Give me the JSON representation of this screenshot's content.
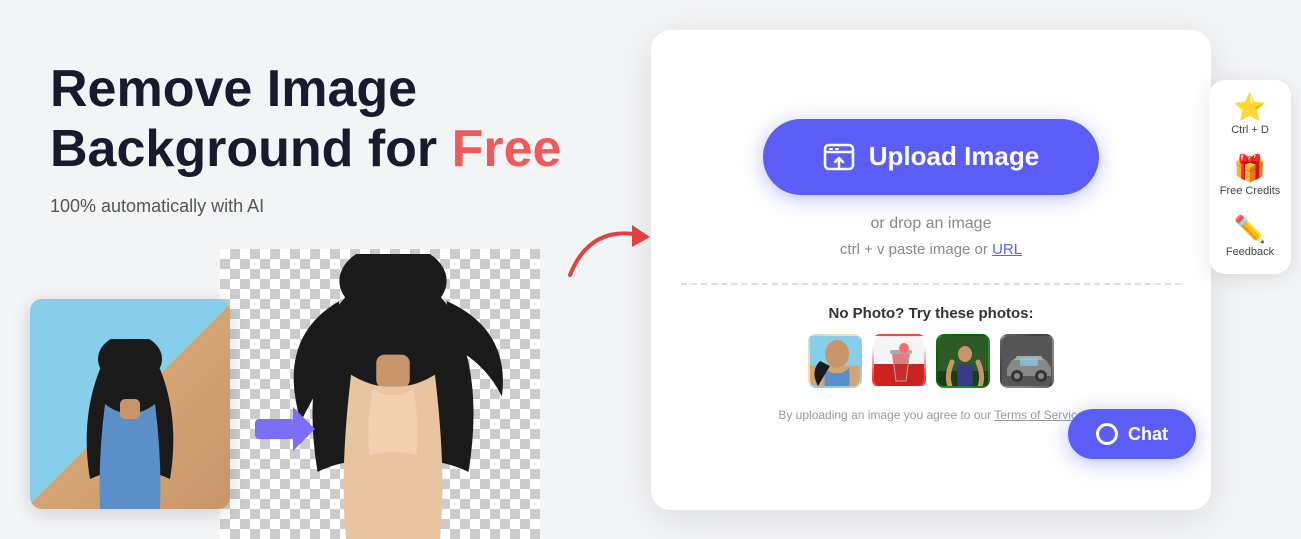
{
  "headline": {
    "line1": "Remove Image",
    "line2": "Background for ",
    "free": "Free"
  },
  "subtitle": "100% automatically with AI",
  "upload": {
    "button_label": "Upload Image",
    "drop_hint": "or drop an image",
    "paste_hint": "ctrl + v paste image or ",
    "url_label": "URL"
  },
  "sample": {
    "label": "No Photo? Try these photos:"
  },
  "tos": {
    "text": "By uploading an image you agree to our ",
    "link_label": "Terms of Service"
  },
  "sidebar": {
    "bookmark_label": "Ctrl + D",
    "credits_label": "Free Credits",
    "feedback_label": "Feedback"
  },
  "chat": {
    "button_label": "Chat"
  },
  "icons": {
    "bookmark": "⭐",
    "credits": "🎁",
    "feedback": "✏️"
  }
}
